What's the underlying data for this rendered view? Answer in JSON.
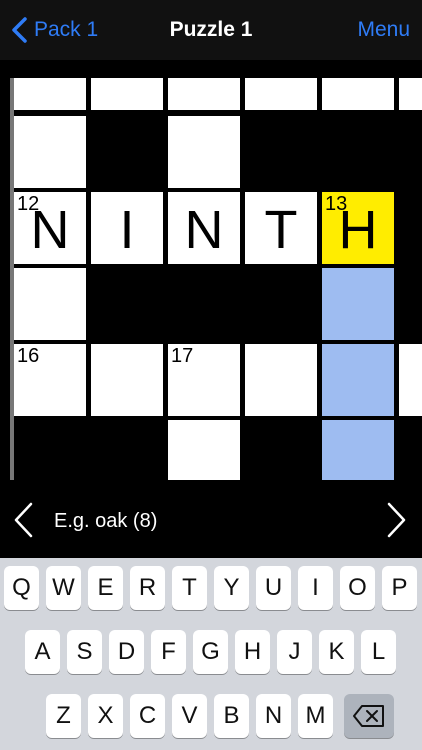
{
  "nav": {
    "back_label": "Pack 1",
    "title": "Puzzle 1",
    "menu_label": "Menu"
  },
  "grid": {
    "row12": {
      "num": "12",
      "letters": [
        "N",
        "I",
        "N",
        "T",
        "H"
      ],
      "num13": "13"
    },
    "num16": "16",
    "num17": "17"
  },
  "clue": {
    "text": "E.g. oak (8)"
  },
  "keyboard": {
    "row1": [
      "Q",
      "W",
      "E",
      "R",
      "T",
      "Y",
      "U",
      "I",
      "O",
      "P"
    ],
    "row2": [
      "A",
      "S",
      "D",
      "F",
      "G",
      "H",
      "J",
      "K",
      "L"
    ],
    "row3": [
      "Z",
      "X",
      "C",
      "V",
      "B",
      "N",
      "M"
    ]
  },
  "colors": {
    "accent": "#2f7cf6",
    "highlight_cell": "#ffed00",
    "word_cell": "#9ebcf1"
  }
}
